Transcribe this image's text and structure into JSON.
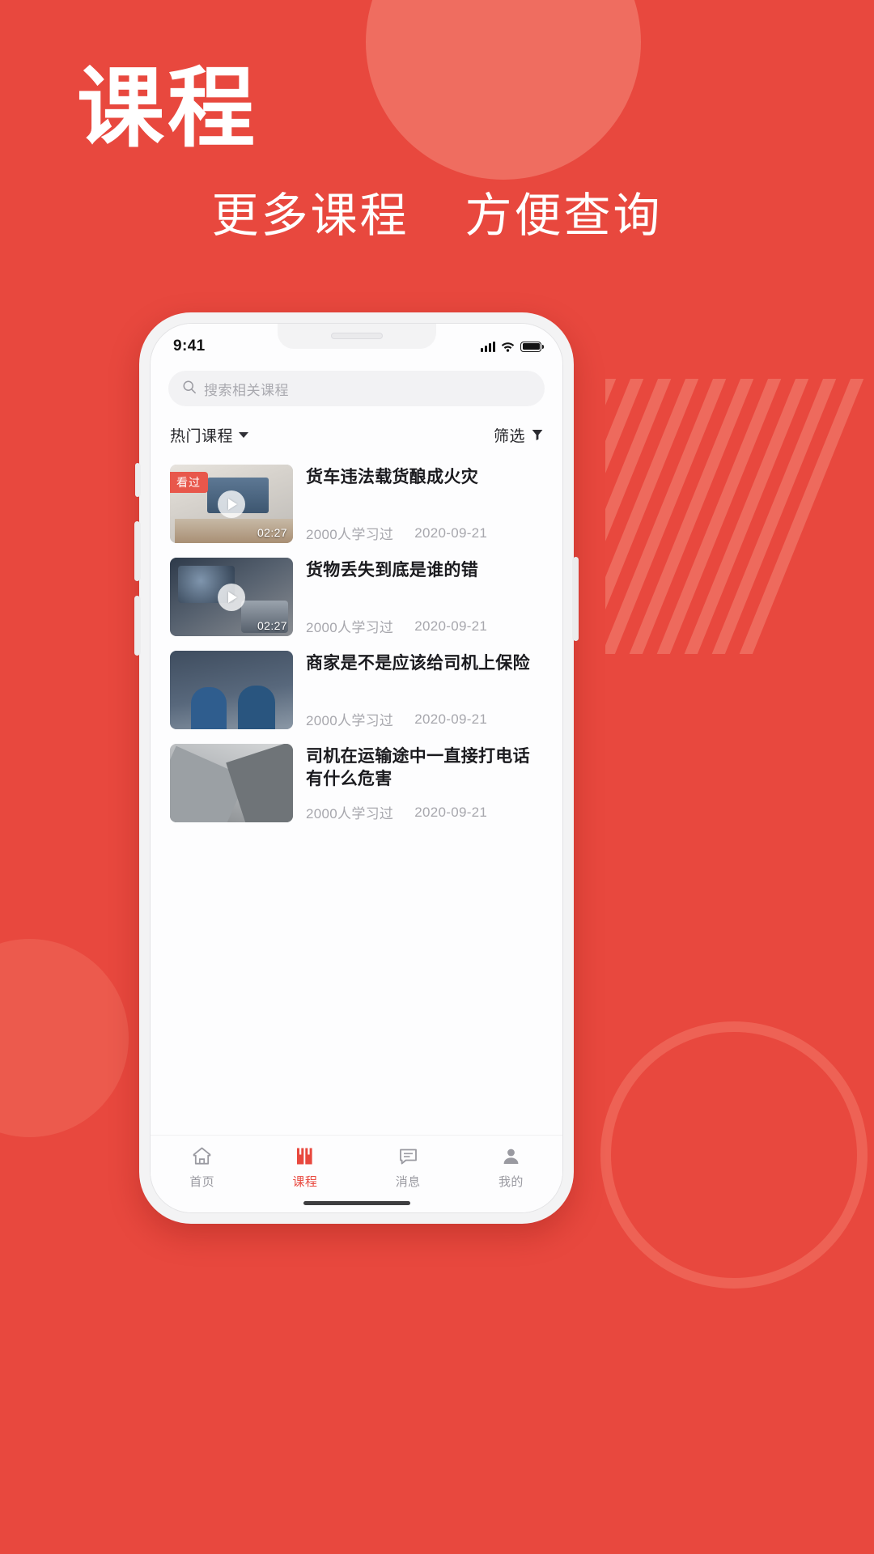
{
  "theme": {
    "brand_red": "#e8483e",
    "accent_light": "#ef6d60",
    "screen_bg": "#fdfdfe"
  },
  "hero": {
    "title": "课程",
    "subtitle_left": "更多课程",
    "subtitle_right": "方便查询"
  },
  "phone": {
    "statusbar": {
      "time": "9:41",
      "signal_icon": "cellular-bars-icon",
      "wifi_icon": "wifi-icon",
      "battery_icon": "battery-full-icon"
    },
    "search": {
      "icon": "search-icon",
      "placeholder": "搜索相关课程",
      "value": ""
    },
    "filter_row": {
      "sort_label": "热门课程",
      "sort_caret_icon": "chevron-down-icon",
      "filter_label": "筛选",
      "filter_icon": "funnel-icon"
    },
    "courses": [
      {
        "title": "货车违法载货酿成火灾",
        "learners": "2000人学习过",
        "date": "2020-09-21",
        "duration": "02:27",
        "badge": "看过",
        "has_badge": true,
        "has_play": true,
        "has_duration": true
      },
      {
        "title": "货物丢失到底是谁的错",
        "learners": "2000人学习过",
        "date": "2020-09-21",
        "duration": "02:27",
        "badge": "",
        "has_badge": false,
        "has_play": true,
        "has_duration": true
      },
      {
        "title": "商家是不是应该给司机上保险",
        "learners": "2000人学习过",
        "date": "2020-09-21",
        "duration": "",
        "badge": "",
        "has_badge": false,
        "has_play": false,
        "has_duration": false
      },
      {
        "title": "司机在运输途中一直接打电话有什么危害",
        "learners": "2000人学习过",
        "date": "2020-09-21",
        "duration": "",
        "badge": "",
        "has_badge": false,
        "has_play": false,
        "has_duration": false
      }
    ],
    "tabbar": {
      "active_index": 1,
      "active_color": "#e8483e",
      "inactive_color": "#9a9aa1",
      "items": [
        {
          "label": "首页",
          "icon": "home-icon"
        },
        {
          "label": "课程",
          "icon": "book-icon"
        },
        {
          "label": "消息",
          "icon": "chat-icon"
        },
        {
          "label": "我的",
          "icon": "person-icon"
        }
      ]
    }
  }
}
